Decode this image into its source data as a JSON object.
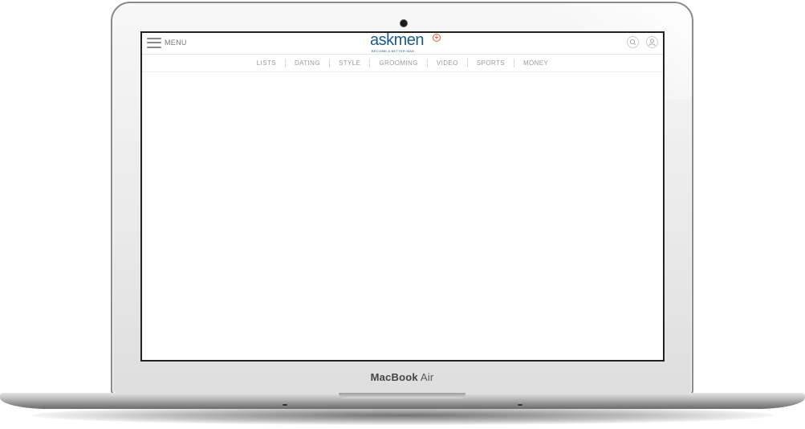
{
  "device": {
    "brand_label_main": "MacBook",
    "brand_label_suffix": "Air"
  },
  "site": {
    "header": {
      "menu_label": "MENU",
      "logo_text": "askmen",
      "logo_plus": "+",
      "logo_tagline": "BECOME A BETTER MAN",
      "icons": [
        "search-icon",
        "user-icon"
      ]
    },
    "nav": {
      "items": [
        "LISTS",
        "DATING",
        "STYLE",
        "GROOMING",
        "VIDEO",
        "SPORTS",
        "MONEY"
      ]
    }
  },
  "colors": {
    "logo_blue": "#1f5a8f",
    "logo_accent": "#e8572a",
    "nav_text": "#9a9a9a"
  }
}
